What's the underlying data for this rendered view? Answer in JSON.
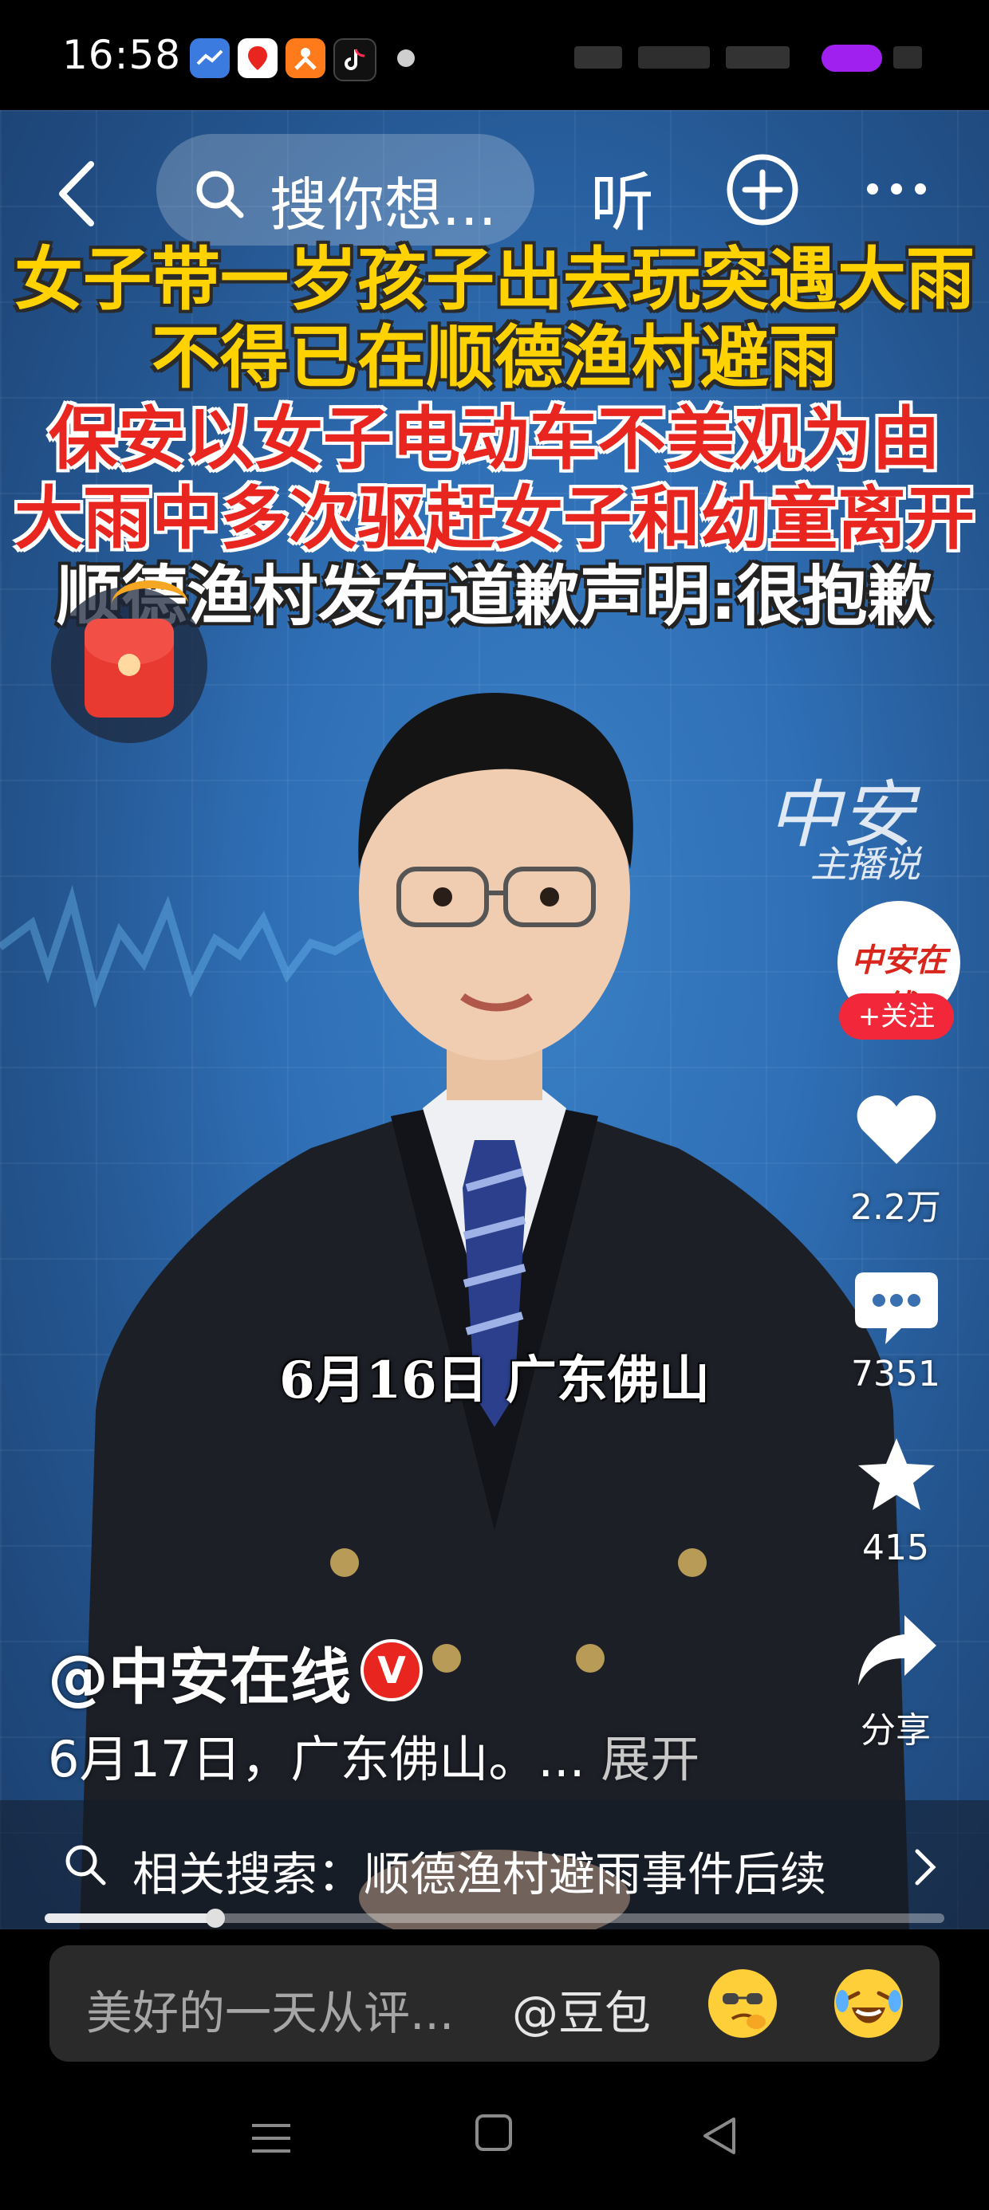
{
  "status_bar": {
    "time": "16:58",
    "apps": [
      "weather-app-icon",
      "map-app-icon",
      "taobao-app-icon",
      "tiktok-app-icon"
    ]
  },
  "top_nav": {
    "search_placeholder": "搜你想...",
    "listen_label": "听"
  },
  "video": {
    "headline_lines": [
      {
        "text": "女子带一岁孩子出去玩突遇大雨",
        "style": "yellow"
      },
      {
        "text": "不得已在顺德渔村避雨",
        "style": "yellow"
      },
      {
        "text": "保安以女子电动车不美观为由",
        "style": "red"
      },
      {
        "text": "大雨中多次驱赶女子和幼童离开",
        "style": "red"
      },
      {
        "text": "顺德渔村发布道歉声明:很抱歉",
        "style": "white"
      }
    ],
    "watermark": "中安",
    "watermark_sub": "主播说",
    "location_caption": "6月16日 广东佛山"
  },
  "rail": {
    "avatar_text": "中安在线",
    "follow_label": "+关注",
    "like_count": "2.2万",
    "comment_count": "7351",
    "favorite_count": "415",
    "share_label": "分享"
  },
  "post": {
    "author": "@中安在线",
    "verified_mark": "V",
    "description": "6月17日，广东佛山。...",
    "expand_label": "展开"
  },
  "related_search": {
    "text": "相关搜索：顺德渔村避雨事件后续"
  },
  "progress": {
    "fraction": 0.19
  },
  "comment_bar": {
    "placeholder": "美好的一天从评...",
    "mention": "@豆包",
    "emojis": [
      "thinking-emoji",
      "laughing-crying-emoji"
    ]
  },
  "colors": {
    "accent_red": "#f2283a",
    "caption_yellow": "#ffd200",
    "caption_red": "#e8261f"
  }
}
